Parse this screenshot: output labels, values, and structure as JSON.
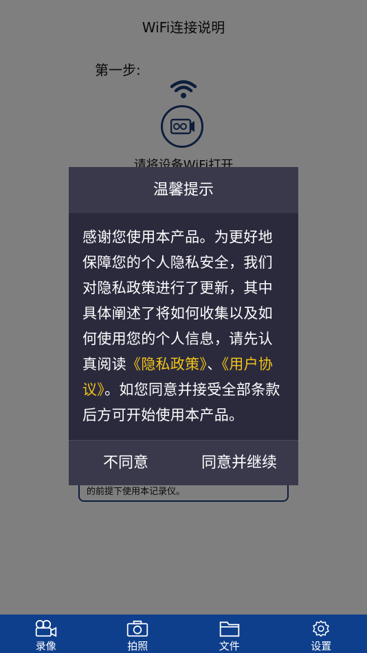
{
  "page": {
    "title": "WiFi连接说明",
    "step_label": "第一步:",
    "hint": "请将设备WiFi打开",
    "agree_note": "的前提下使用本记录仪。"
  },
  "dialog": {
    "title": "温馨提示",
    "body_part1": "感谢您使用本产品。为更好地保障您的个人隐私安全，我们对隐私政策进行了更新，其中具体阐述了将如何收集以及如何使用您的个人信息，请先认真阅读",
    "privacy_link": "《隐私政策》",
    "separator": "、",
    "user_link": "《用户协议》",
    "body_part2": "。如您同意并接受全部条款后方可开始使用本产品。",
    "disagree_label": "不同意",
    "agree_label": "同意并继续"
  },
  "tabbar": {
    "items": [
      {
        "label": "录像",
        "icon": "video-camera-icon"
      },
      {
        "label": "拍照",
        "icon": "camera-icon"
      },
      {
        "label": "文件",
        "icon": "folder-icon"
      },
      {
        "label": "设置",
        "icon": "gear-icon"
      }
    ]
  },
  "colors": {
    "tabbar_bg": "#0e3f8c",
    "dialog_bg": "#2b2a3d",
    "dialog_header_bg": "#3a394c",
    "link": "#f0c419",
    "accent": "#1b3a78"
  }
}
